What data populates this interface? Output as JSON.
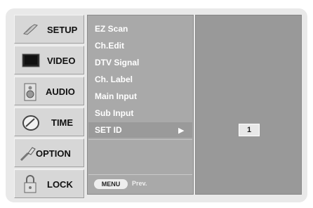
{
  "sidebar": {
    "items": [
      {
        "label": "SETUP",
        "icon": "setup-icon"
      },
      {
        "label": "VIDEO",
        "icon": "tv-icon"
      },
      {
        "label": "AUDIO",
        "icon": "speaker-icon"
      },
      {
        "label": "TIME",
        "icon": "clock-icon"
      },
      {
        "label": "OPTION",
        "icon": "option-icon"
      },
      {
        "label": "LOCK",
        "icon": "lock-icon"
      }
    ]
  },
  "submenu": {
    "items": [
      "EZ Scan",
      "Ch.Edit",
      "DTV Signal",
      "Ch. Label",
      "Main Input",
      "Sub Input"
    ],
    "selected": {
      "label": "SET ID",
      "arrow": "▶"
    }
  },
  "footer": {
    "menu_label": "MENU",
    "prev_label": "Prev."
  },
  "value_panel": {
    "set_id_value": "1"
  },
  "colors": {
    "frame": "#e9e9e9",
    "tab": "#d7d7d7",
    "submenu_bg": "#a9a9a9",
    "panel_bg": "#999999"
  }
}
